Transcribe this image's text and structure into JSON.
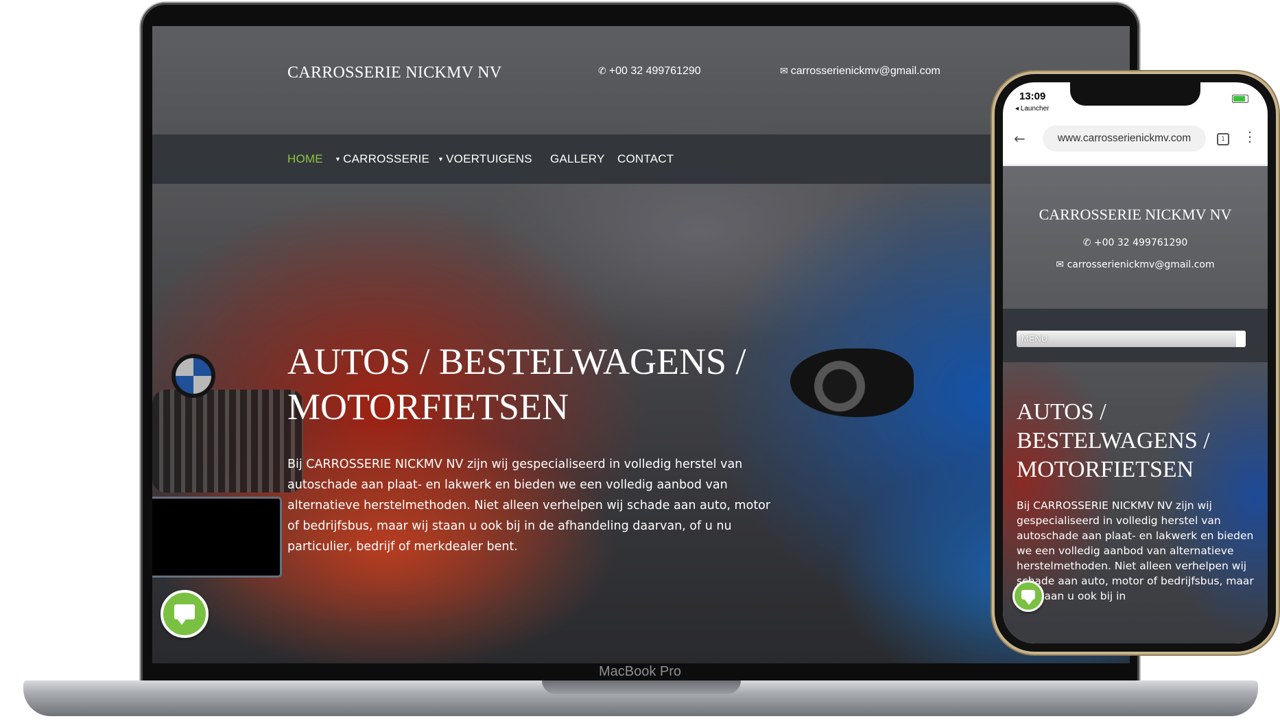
{
  "laptop": {
    "brand": "MacBook Pro",
    "site": {
      "title": "CARROSSERIE NICKMV NV",
      "phone": "+00 32 499761290",
      "email": "carrosserienickmv@gmail.com",
      "phone_icon": "phone-icon",
      "email_icon": "envelope-icon"
    },
    "nav": [
      {
        "label": "HOME",
        "active": true
      },
      {
        "label": "CARROSSERIE",
        "dropdown": true
      },
      {
        "label": "VOERTUIGENS",
        "dropdown": true
      },
      {
        "label": "GALLERY"
      },
      {
        "label": "CONTACT"
      }
    ],
    "hero": {
      "title_line1": "AUTOS / BESTELWAGENS /",
      "title_line2": "MOTORFIETSEN",
      "text": "Bij CARROSSERIE NICKMV NV zijn wij gespecialiseerd in volledig herstel van autoschade aan plaat- en lakwerk en bieden we een volledig aanbod van alternatieve herstelmethoden. Niet alleen verhelpen wij schade aan auto, motor of bedrijfsbus, maar wij staan u ook bij in de afhandeling daarvan, of u nu particulier, bedrijf of merkdealer bent."
    },
    "chat_icon": "chat-bubble-icon"
  },
  "phone": {
    "status": {
      "time": "13:09",
      "back_app": "◂ Launcher"
    },
    "browser": {
      "url": "www.carrosserienickmv.com",
      "tabs_count": "1"
    },
    "site": {
      "title": "CARROSSERIE NICKMV NV",
      "phone": "+00 32 499761290",
      "email": "carrosserienickmv@gmail.com",
      "menu_label": "MENU",
      "hero_title": "AUTOS / BESTELWAGENS / MOTORFIETSEN",
      "hero_text": "Bij CARROSSERIE NICKMV NV zijn wij gespecialiseerd in volledig herstel van autoschade aan plaat- en lakwerk en bieden we een volledig aanbod van alternatieve herstelmethoden. Niet alleen verhelpen wij schade aan auto, motor of bedrijfsbus, maar wij staan u ook bij in"
    }
  },
  "colors": {
    "accent_green": "#8cc63f",
    "chat_green": "#7ac143",
    "nav_bg": "#30343a"
  }
}
